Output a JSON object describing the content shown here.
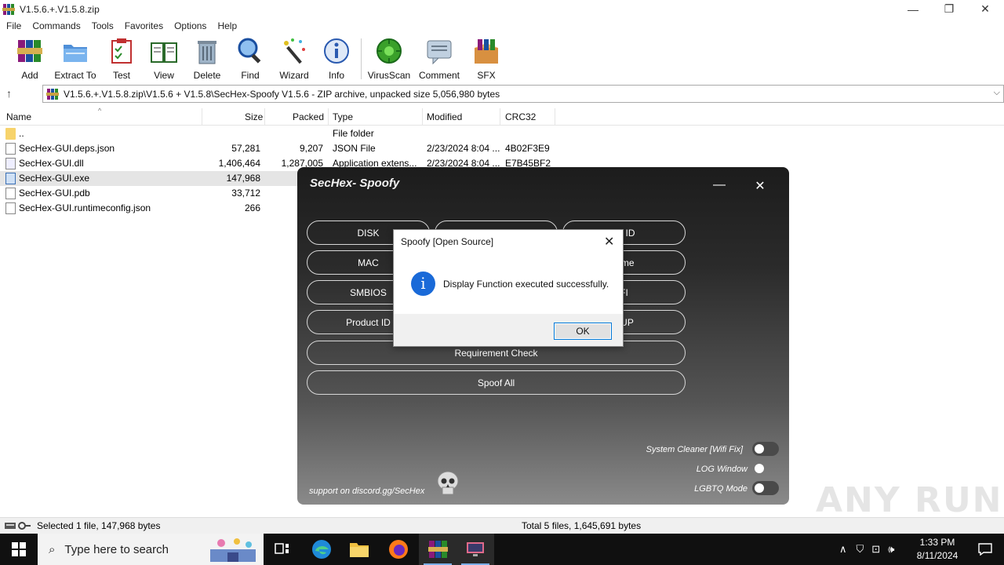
{
  "window": {
    "title": "V1.5.6.+.V1.5.8.zip",
    "minimize": "—",
    "maximize": "❐",
    "close": "✕"
  },
  "menu": [
    "File",
    "Commands",
    "Tools",
    "Favorites",
    "Options",
    "Help"
  ],
  "toolbar": [
    {
      "label": "Add",
      "icon": "add-archive-icon"
    },
    {
      "label": "Extract To",
      "icon": "extract-folder-icon"
    },
    {
      "label": "Test",
      "icon": "test-clipboard-icon"
    },
    {
      "label": "View",
      "icon": "view-book-icon"
    },
    {
      "label": "Delete",
      "icon": "trash-icon"
    },
    {
      "label": "Find",
      "icon": "magnifier-icon"
    },
    {
      "label": "Wizard",
      "icon": "wand-icon"
    },
    {
      "label": "Info",
      "icon": "info-icon"
    },
    {
      "label": "VirusScan",
      "icon": "virus-scan-icon"
    },
    {
      "label": "Comment",
      "icon": "comment-icon"
    },
    {
      "label": "SFX",
      "icon": "sfx-box-icon"
    }
  ],
  "address": {
    "path": "V1.5.6.+.V1.5.8.zip\\V1.5.6  + V1.5.8\\SecHex-Spoofy V1.5.6 - ZIP archive, unpacked size 5,056,980 bytes"
  },
  "columns": {
    "name": "Name",
    "size": "Size",
    "packed": "Packed",
    "type": "Type",
    "modified": "Modified",
    "crc": "CRC32"
  },
  "files": [
    {
      "name": "..",
      "size": "",
      "packed": "",
      "type": "File folder",
      "modified": "",
      "crc": "",
      "kind": "folder"
    },
    {
      "name": "SecHex-GUI.deps.json",
      "size": "57,281",
      "packed": "9,207",
      "type": "JSON File",
      "modified": "2/23/2024 8:04 ...",
      "crc": "4B02F3E9",
      "kind": "file"
    },
    {
      "name": "SecHex-GUI.dll",
      "size": "1,406,464",
      "packed": "1,287,005",
      "type": "Application extens...",
      "modified": "2/23/2024 8:04 ...",
      "crc": "E7B45BF2",
      "kind": "dll"
    },
    {
      "name": "SecHex-GUI.exe",
      "size": "147,968",
      "packed": "",
      "type": "",
      "modified": "",
      "crc": "",
      "kind": "exe"
    },
    {
      "name": "SecHex-GUI.pdb",
      "size": "33,712",
      "packed": "",
      "type": "",
      "modified": "",
      "crc": "",
      "kind": "file"
    },
    {
      "name": "SecHex-GUI.runtimeconfig.json",
      "size": "266",
      "packed": "",
      "type": "",
      "modified": "",
      "crc": "",
      "kind": "file"
    }
  ],
  "status": {
    "left": "Selected 1 file, 147,968 bytes",
    "right": "Total 5 files, 1,645,691 bytes"
  },
  "sechex": {
    "title": "SecHex- Spoofy",
    "minimize": "—",
    "close": "✕",
    "buttons": {
      "disk": "DISK",
      "display_id": "ay ID",
      "mac": "MAC",
      "pc_name": "lame",
      "smbios": "SMBIOS",
      "efi": "FI",
      "product_id": "Product ID",
      "backup": "KUP",
      "requirement": "Requirement Check",
      "spoof_all": "Spoof All"
    },
    "toggles": [
      {
        "label": "System Cleaner [Wifi Fix]",
        "on": false
      },
      {
        "label": "LOG Window",
        "on": false
      },
      {
        "label": "LGBTQ Mode",
        "on": false
      }
    ],
    "support": "support on discord.gg/SecHex"
  },
  "dialog": {
    "title": "Spoofy [Open Source]",
    "message": "Display Function executed successfully.",
    "ok": "OK",
    "info_glyph": "i",
    "close": "✕"
  },
  "watermark": "ANY RUN",
  "taskbar": {
    "search_placeholder": "Type here to search",
    "time": "1:33 PM",
    "date": "8/11/2024"
  }
}
